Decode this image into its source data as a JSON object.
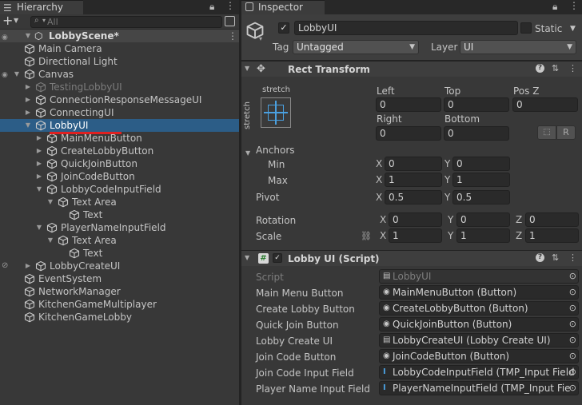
{
  "hierarchy": {
    "tab_title": "Hierarchy",
    "search_placeholder": "All",
    "add_label": "+",
    "scene_name": "LobbyScene*",
    "items": [
      {
        "label": "Main Camera"
      },
      {
        "label": "Directional Light"
      },
      {
        "label": "Canvas"
      },
      {
        "label": "TestingLobbyUI"
      },
      {
        "label": "ConnectionResponseMessageUI"
      },
      {
        "label": "ConnectingUI"
      },
      {
        "label": "LobbyUI"
      },
      {
        "label": "MainMenuButton"
      },
      {
        "label": "CreateLobbyButton"
      },
      {
        "label": "QuickJoinButton"
      },
      {
        "label": "JoinCodeButton"
      },
      {
        "label": "LobbyCodeInputField"
      },
      {
        "label": "Text Area"
      },
      {
        "label": "Text"
      },
      {
        "label": "PlayerNameInputField"
      },
      {
        "label": "Text Area"
      },
      {
        "label": "Text"
      },
      {
        "label": "LobbyCreateUI"
      },
      {
        "label": "EventSystem"
      },
      {
        "label": "NetworkManager"
      },
      {
        "label": "KitchenGameMultiplayer"
      },
      {
        "label": "KitchenGameLobby"
      }
    ]
  },
  "inspector": {
    "tab_title": "Inspector",
    "object_name": "LobbyUI",
    "static_label": "Static",
    "tag_label": "Tag",
    "tag_value": "Untagged",
    "layer_label": "Layer",
    "layer_value": "UI",
    "rect_transform": {
      "title": "Rect Transform",
      "anchor_preset_top": "stretch",
      "anchor_preset_side": "stretch",
      "left_label": "Left",
      "left": "0",
      "top_label": "Top",
      "top": "0",
      "posz_label": "Pos Z",
      "posz": "0",
      "right_label": "Right",
      "right": "0",
      "bottom_label": "Bottom",
      "bottom": "0",
      "r_button": "R",
      "anchors_label": "Anchors",
      "min_label": "Min",
      "min_x": "0",
      "min_y": "0",
      "max_label": "Max",
      "max_x": "1",
      "max_y": "1",
      "pivot_label": "Pivot",
      "pivot_x": "0.5",
      "pivot_y": "0.5",
      "rotation_label": "Rotation",
      "rot_x": "0",
      "rot_y": "0",
      "rot_z": "0",
      "scale_label": "Scale",
      "scale_x": "1",
      "scale_y": "1",
      "scale_z": "1",
      "axis_x": "X",
      "axis_y": "Y",
      "axis_z": "Z"
    },
    "script_component": {
      "title": "Lobby UI (Script)",
      "fields": [
        {
          "label": "Script",
          "value": "LobbyUI",
          "icon": "script-icon"
        },
        {
          "label": "Main Menu Button",
          "value": "MainMenuButton (Button)",
          "icon": "object-dot-icon"
        },
        {
          "label": "Create Lobby Button",
          "value": "CreateLobbyButton (Button)",
          "icon": "object-dot-icon"
        },
        {
          "label": "Quick Join Button",
          "value": "QuickJoinButton (Button)",
          "icon": "object-dot-icon"
        },
        {
          "label": "Lobby Create UI",
          "value": "LobbyCreateUI (Lobby Create UI)",
          "icon": "script-icon"
        },
        {
          "label": "Join Code Button",
          "value": "JoinCodeButton (Button)",
          "icon": "object-dot-icon"
        },
        {
          "label": "Join Code Input Field",
          "value": "LobbyCodeInputField (TMP_Input Field",
          "icon": "text-cursor-icon"
        },
        {
          "label": "Player Name Input Field",
          "value": "PlayerNameInputField (TMP_Input Fie",
          "icon": "text-cursor-icon"
        }
      ]
    }
  },
  "colors": {
    "selection": "#2c5d87",
    "underline": "#e02020",
    "panel": "#383838"
  }
}
